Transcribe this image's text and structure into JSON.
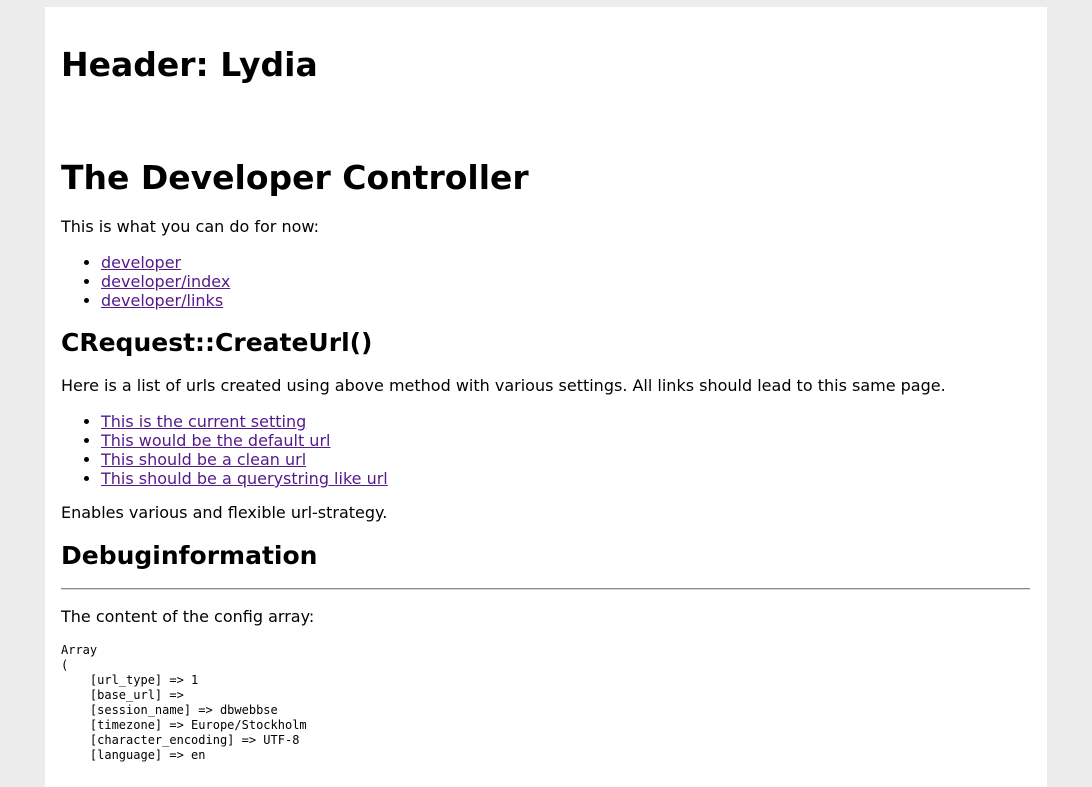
{
  "site": {
    "header": "Header: Lydia"
  },
  "main": {
    "title": "The Developer Controller",
    "intro": "This is what you can do for now:",
    "nav_links": [
      {
        "label": "developer"
      },
      {
        "label": "developer/index"
      },
      {
        "label": "developer/links"
      }
    ],
    "url_section": {
      "title": "CRequest::CreateUrl()",
      "description": "Here is a list of urls created using above method with various settings. All links should lead to this same page.",
      "links": [
        {
          "label": "This is the current setting"
        },
        {
          "label": "This would be the default url"
        },
        {
          "label": "This should be a clean url"
        },
        {
          "label": "This should be a querystring like url"
        }
      ],
      "footer": "Enables various and flexible url-strategy."
    },
    "debug": {
      "title": "Debuginformation",
      "config_label": "The content of the config array:",
      "config_dump": "Array\n(\n    [url_type] => 1\n    [base_url] => \n    [session_name] => dbwebbse\n    [timezone] => Europe/Stockholm\n    [character_encoding] => UTF-8\n    [language] => en"
    }
  },
  "colors": {
    "background": "#ececec",
    "page": "#ffffff",
    "link_visited": "#551a8b",
    "text": "#000000"
  }
}
